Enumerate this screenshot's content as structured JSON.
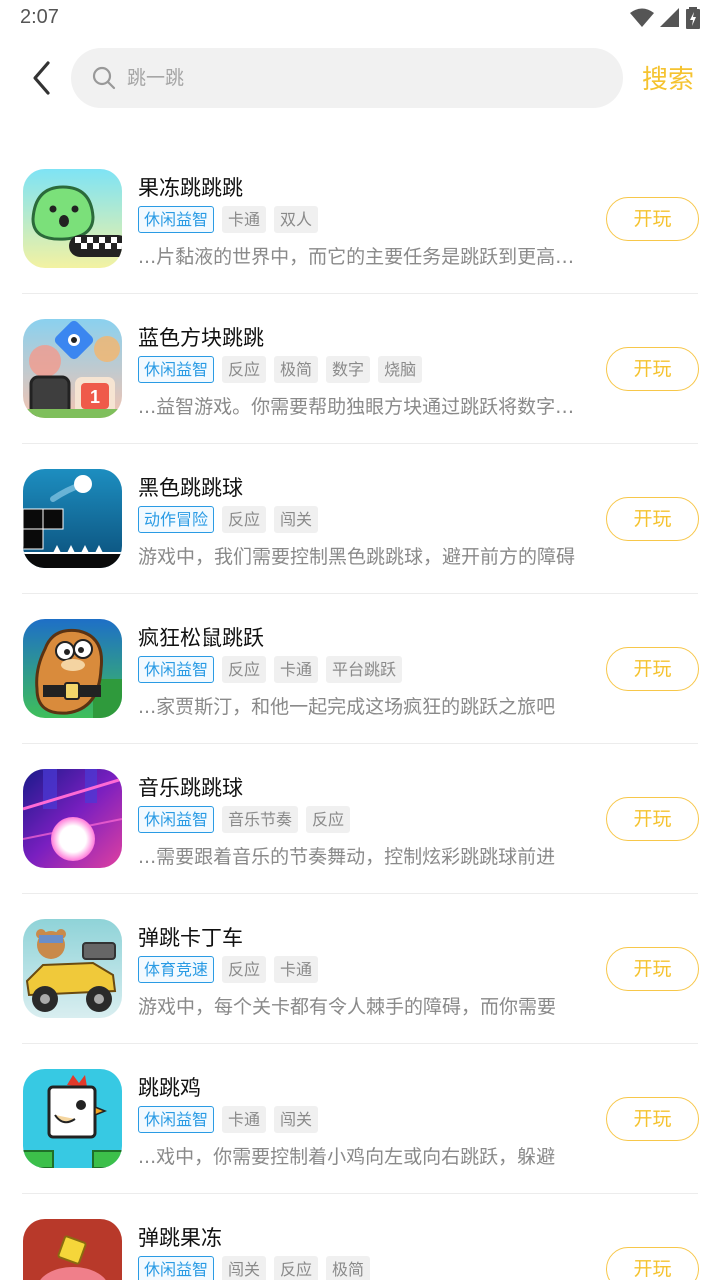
{
  "status_bar": {
    "time": "2:07"
  },
  "search": {
    "placeholder": "跳一跳",
    "action_label": "搜索"
  },
  "colors": {
    "accent": "#f5c330",
    "tag_primary": "#2a9be4",
    "tag_secondary_bg": "#f0f0f0",
    "muted_text": "#8a8a8a"
  },
  "games": [
    {
      "icon": "jelly-jump-icon",
      "title": "果冻跳跳跳",
      "primary_tag": "休闲益智",
      "tags": [
        "卡通",
        "双人"
      ],
      "desc": "...片黏液的世界中，而它的主要任务是跳跃到更高的地方",
      "play_label": "开玩"
    },
    {
      "icon": "blue-block-jump-icon",
      "title": "蓝色方块跳跳",
      "primary_tag": "休闲益智",
      "tags": [
        "反应",
        "极简",
        "数字",
        "烧脑"
      ],
      "desc": "...益智游戏。你需要帮助独眼方块通过跳跃将数字方块",
      "play_label": "开玩"
    },
    {
      "icon": "black-bounce-ball-icon",
      "title": "黑色跳跳球",
      "primary_tag": "动作冒险",
      "tags": [
        "反应",
        "闯关"
      ],
      "desc": "游戏中，我们需要控制黑色跳跳球，避开前方的障碍",
      "play_label": "开玩"
    },
    {
      "icon": "crazy-squirrel-icon",
      "title": "疯狂松鼠跳跃",
      "primary_tag": "休闲益智",
      "tags": [
        "反应",
        "卡通",
        "平台跳跃"
      ],
      "desc": "...家贾斯汀，和他一起完成这场疯狂的跳跃之旅吧",
      "play_label": "开玩"
    },
    {
      "icon": "music-bounce-ball-icon",
      "title": "音乐跳跳球",
      "primary_tag": "休闲益智",
      "tags": [
        "音乐节奏",
        "反应"
      ],
      "desc": "...需要跟着音乐的节奏舞动，控制炫彩跳跳球前进",
      "play_label": "开玩"
    },
    {
      "icon": "bounce-kart-icon",
      "title": "弹跳卡丁车",
      "primary_tag": "体育竞速",
      "tags": [
        "反应",
        "卡通"
      ],
      "desc": "游戏中，每个关卡都有令人棘手的障碍，而你需要",
      "play_label": "开玩"
    },
    {
      "icon": "jumping-chicken-icon",
      "title": "跳跳鸡",
      "primary_tag": "休闲益智",
      "tags": [
        "卡通",
        "闯关"
      ],
      "desc": "...戏中，你需要控制着小鸡向左或向右跳跃，躲避",
      "play_label": "开玩"
    },
    {
      "icon": "bounce-jelly-icon",
      "title": "弹跳果冻",
      "primary_tag": "休闲益智",
      "tags": [
        "闯关",
        "反应",
        "极简"
      ],
      "desc": "",
      "play_label": "开玩"
    }
  ]
}
